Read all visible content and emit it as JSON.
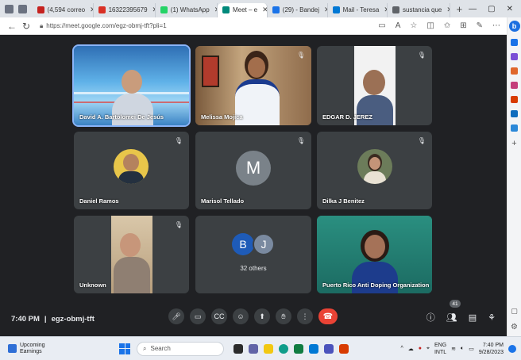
{
  "browser": {
    "tabs": [
      {
        "label": "(4,594 correo",
        "color": "#c5221f"
      },
      {
        "label": "16322395679",
        "color": "#d93025"
      },
      {
        "label": "(1) WhatsApp",
        "color": "#25d366"
      },
      {
        "label": "Meet – e",
        "color": "#00897b",
        "active": true
      },
      {
        "label": "(29) - Bandej",
        "color": "#1a73e8"
      },
      {
        "label": "Mail - Teresa",
        "color": "#0078d4"
      },
      {
        "label": "sustancia que",
        "color": "#5f6368"
      }
    ],
    "url": "https://meet.google.com/egz-obmj-tft?pli=1"
  },
  "meet": {
    "participants": [
      {
        "name": "David A. Bartolomei De Jesús",
        "kind": "video"
      },
      {
        "name": "Melissa Mojica",
        "kind": "video"
      },
      {
        "name": "EDGAR D. JEREZ",
        "kind": "video"
      },
      {
        "name": "Daniel Ramos",
        "kind": "photo"
      },
      {
        "name": "Marisol Tellado",
        "kind": "initial",
        "initial": "M"
      },
      {
        "name": "Dilka J Benitez",
        "kind": "photo"
      },
      {
        "name": "Unknown",
        "kind": "video"
      },
      {
        "name": "32 others",
        "kind": "others",
        "initials": [
          "B",
          "J"
        ]
      },
      {
        "name": "Puerto Rico Anti Doping Organization",
        "kind": "video"
      }
    ],
    "time": "7:40 PM",
    "separator": "|",
    "code": "egz-obmj-tft",
    "participant_count": "41"
  },
  "taskbar": {
    "weather_title": "Upcoming",
    "weather_sub": "Earnings",
    "search_placeholder": "Search",
    "lang_top": "ENG",
    "lang_bottom": "INTL",
    "clock_time": "7:40 PM",
    "clock_date": "9/28/2023"
  }
}
